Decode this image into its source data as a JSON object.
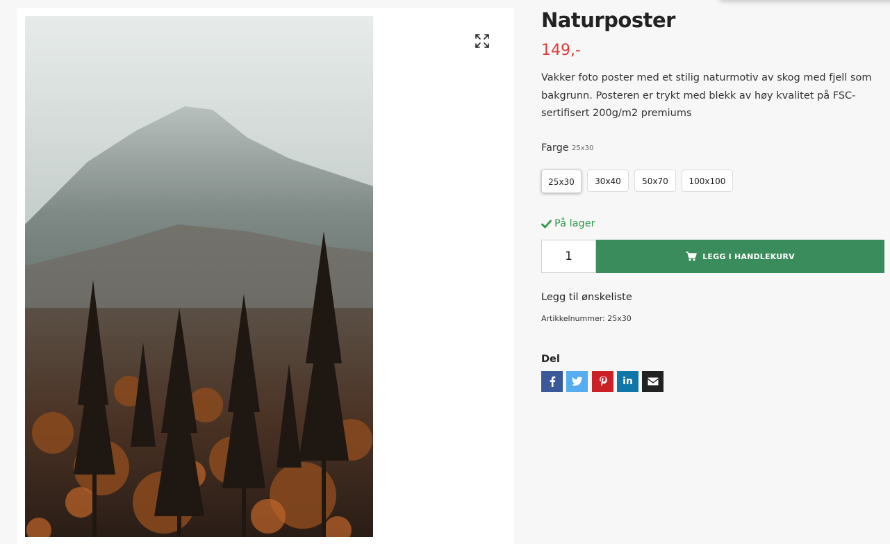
{
  "product": {
    "title": "Naturposter",
    "price": "149,-",
    "description": "Vakker foto poster med et stilig naturmotiv av skog med fjell som bakgrunn. Posteren er trykt med blekk av høy kvalitet på FSC-sertifisert 200g/m2 premiums",
    "variant_label": "Farge",
    "variant_selected": "25x30",
    "variants": [
      "25x30",
      "30x40",
      "50x70",
      "100x100"
    ],
    "stock_text": "På lager",
    "quantity": "1",
    "add_to_cart": "LEGG I HANDLEKURV",
    "wishlist": "Legg til ønskeliste",
    "sku": "Artikkelnummer: 25x30",
    "share_label": "Del"
  },
  "colors": {
    "price": "#e03a3a",
    "stock": "#2f9a47",
    "cart_button": "#3a8c5c",
    "facebook": "#3b5998",
    "twitter": "#55acee",
    "pinterest": "#cb2027",
    "linkedin": "#0e76a8",
    "email": "#222222"
  },
  "icons": [
    "expand-icon",
    "check-icon",
    "cart-icon",
    "facebook-icon",
    "twitter-icon",
    "pinterest-icon",
    "linkedin-icon",
    "envelope-icon"
  ]
}
